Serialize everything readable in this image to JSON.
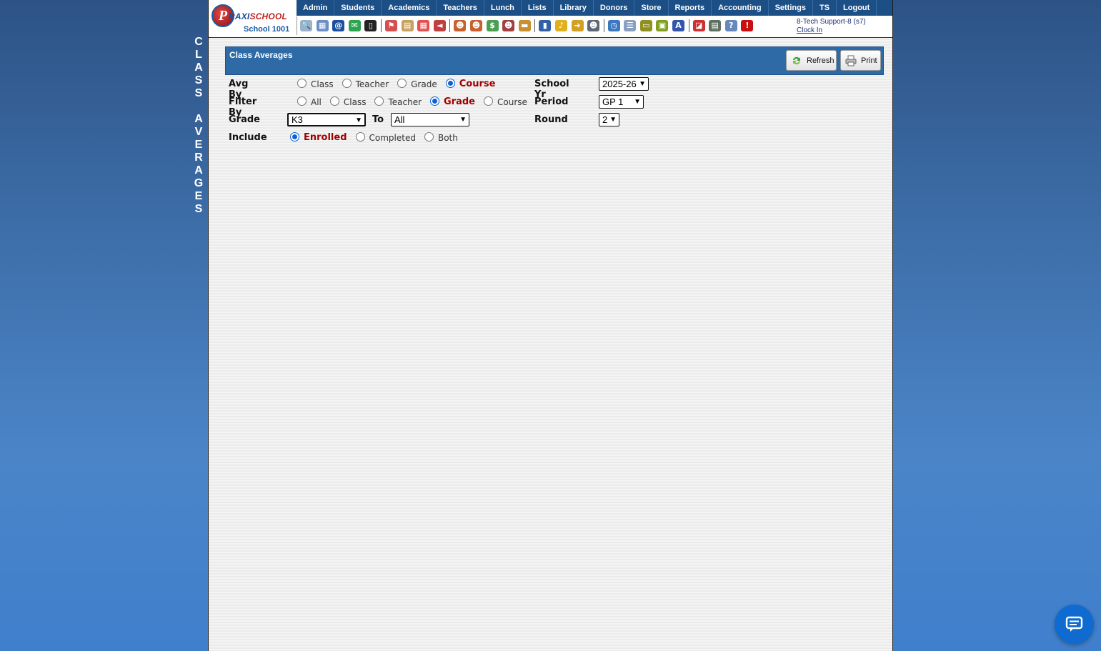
{
  "side_title": [
    "C",
    "L",
    "A",
    "S",
    "S",
    " ",
    "A",
    "V",
    "E",
    "R",
    "A",
    "G",
    "E",
    "S"
  ],
  "logo": {
    "brand_p": "P",
    "brand_a": "RAXI",
    "brand_b": "SCHOOL",
    "school": "School 1001"
  },
  "nav": [
    "Admin",
    "Students",
    "Academics",
    "Teachers",
    "Lunch",
    "Lists",
    "Library",
    "Donors",
    "Store",
    "Reports",
    "Accounting",
    "Settings",
    "TS",
    "Logout"
  ],
  "toolbar_icons": [
    {
      "name": "search-icon",
      "color": "#9ab3cc",
      "glyph": "🔍"
    },
    {
      "name": "calendar-grid-icon",
      "color": "#6a8fc4",
      "glyph": "▦"
    },
    {
      "name": "email-icon",
      "color": "#1b4fa0",
      "glyph": "@"
    },
    {
      "name": "chat-icon",
      "color": "#2da44e",
      "glyph": "✉"
    },
    {
      "name": "phone-icon",
      "color": "#222",
      "glyph": "▯"
    },
    {
      "name": "bookmark-icon",
      "color": "#d45050",
      "glyph": "⚑"
    },
    {
      "name": "form-icon",
      "color": "#c8a060",
      "glyph": "▤"
    },
    {
      "name": "calendar-icon",
      "color": "#e25050",
      "glyph": "▦"
    },
    {
      "name": "megaphone-icon",
      "color": "#c04040",
      "glyph": "◄"
    },
    {
      "name": "student-icon",
      "color": "#c86030",
      "glyph": "☻"
    },
    {
      "name": "teacher-icon",
      "color": "#c86030",
      "glyph": "☻"
    },
    {
      "name": "money-icon",
      "color": "#4aa050",
      "glyph": "$"
    },
    {
      "name": "users-icon",
      "color": "#a04040",
      "glyph": "☻"
    },
    {
      "name": "lunch-icon",
      "color": "#c89030",
      "glyph": "▬"
    },
    {
      "name": "book-icon",
      "color": "#3060a8",
      "glyph": "▮"
    },
    {
      "name": "bell-icon",
      "color": "#e0b020",
      "glyph": "♪"
    },
    {
      "name": "arrow-icon",
      "color": "#d4a020",
      "glyph": "➜"
    },
    {
      "name": "person-icon",
      "color": "#606878",
      "glyph": "☻"
    },
    {
      "name": "clock-icon",
      "color": "#3a78c0",
      "glyph": "◷"
    },
    {
      "name": "list-icon",
      "color": "#8aa0c0",
      "glyph": "☰"
    },
    {
      "name": "card-icon",
      "color": "#909020",
      "glyph": "▭"
    },
    {
      "name": "printer-icon",
      "color": "#80a020",
      "glyph": "▣"
    },
    {
      "name": "ap-icon",
      "color": "#3355aa",
      "glyph": "A"
    },
    {
      "name": "pdf-icon",
      "color": "#cc3030",
      "glyph": "◪"
    },
    {
      "name": "cash-icon",
      "color": "#607060",
      "glyph": "▤"
    },
    {
      "name": "help-icon",
      "color": "#6688bb",
      "glyph": "?"
    },
    {
      "name": "alert-icon",
      "color": "#c81010",
      "glyph": "!"
    }
  ],
  "user": {
    "name": "8-Tech Support-8 (s7)",
    "clock_in": "Clock In"
  },
  "section": {
    "title": "Class Averages",
    "refresh": "Refresh",
    "print": "Print"
  },
  "form": {
    "avg_by": {
      "label": "Avg By",
      "options": [
        "Class",
        "Teacher",
        "Grade",
        "Course"
      ],
      "selected": "Course"
    },
    "filter_by": {
      "label": "Filter By",
      "options": [
        "All",
        "Class",
        "Teacher",
        "Grade",
        "Course"
      ],
      "selected": "Grade"
    },
    "grade": {
      "label": "Grade",
      "from": "K3",
      "to_label": "To",
      "to": "All"
    },
    "include": {
      "label": "Include",
      "options": [
        "Enrolled",
        "Completed",
        "Both"
      ],
      "selected": "Enrolled"
    },
    "school_yr": {
      "label": "School Yr",
      "value": "2025-26"
    },
    "period": {
      "label": "Period",
      "value": "GP 1"
    },
    "round": {
      "label": "Round",
      "value": "2"
    }
  }
}
